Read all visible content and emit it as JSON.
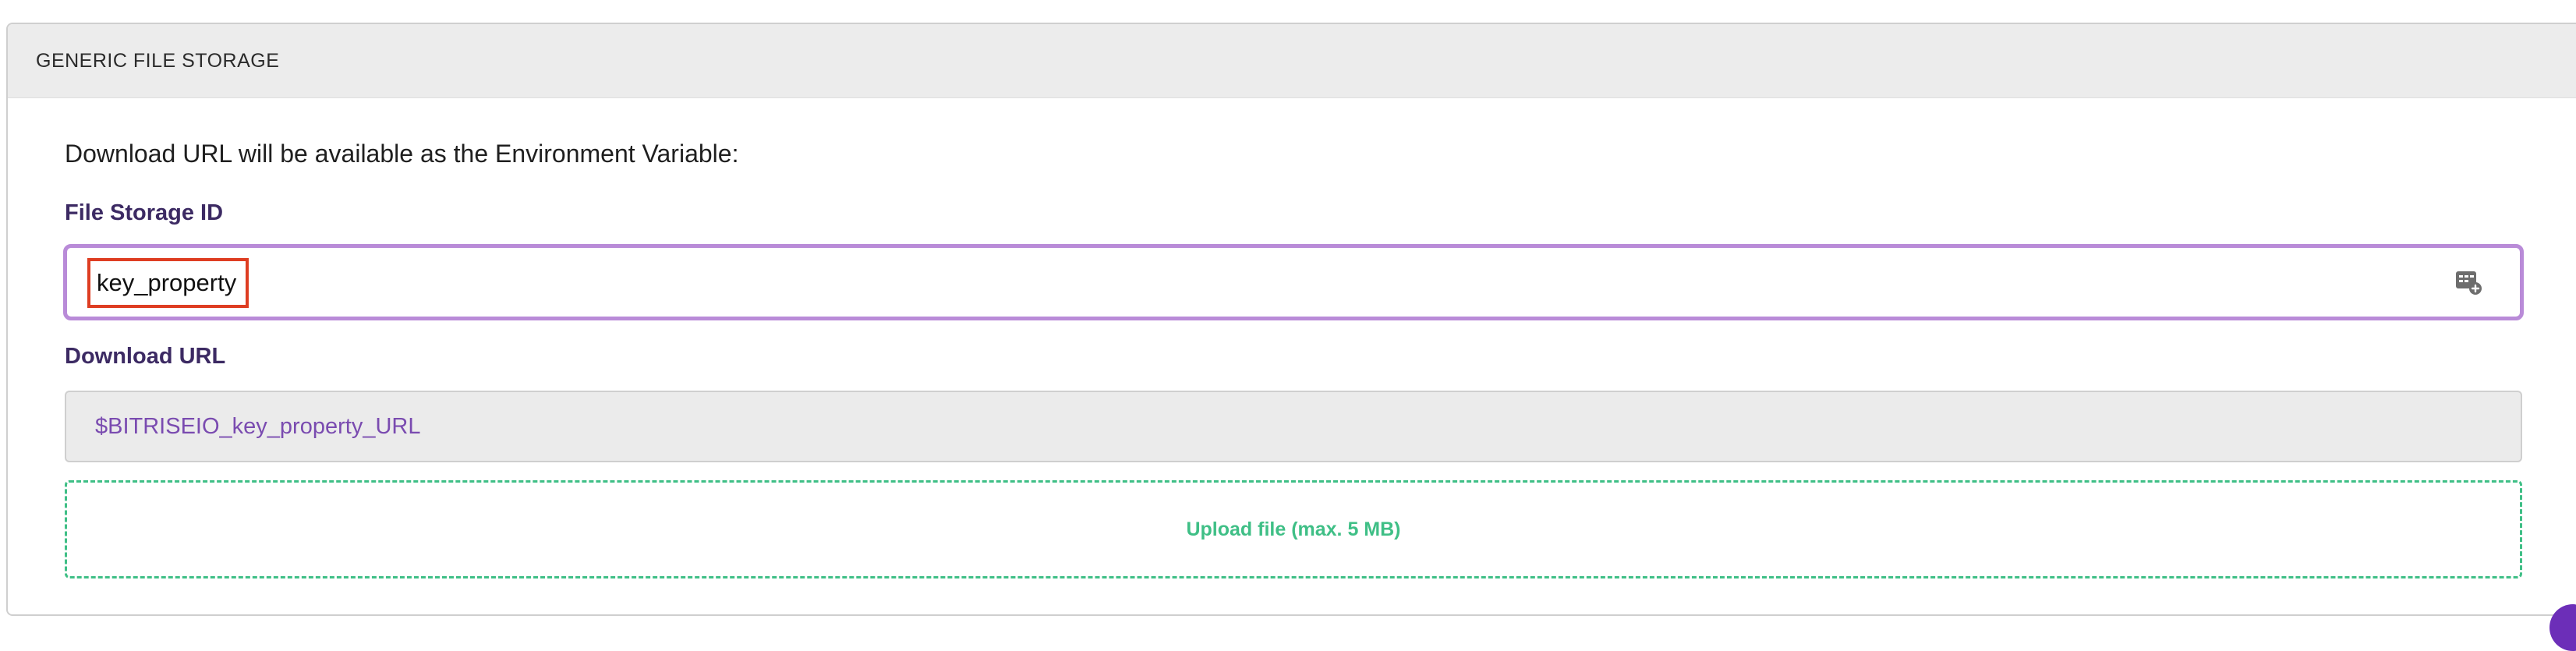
{
  "section": {
    "title": "GENERIC FILE STORAGE",
    "intro_text": "Download URL will be available as the Environment Variable:"
  },
  "file_storage_id": {
    "label": "File Storage ID",
    "value": "key_property",
    "insert_variable_icon": "insert-variable-icon"
  },
  "download_url": {
    "label": "Download URL",
    "value": "$BITRISEIO_key_property_URL"
  },
  "upload": {
    "label": "Upload file (max. 5 MB)"
  },
  "colors": {
    "header_bg": "#ececec",
    "label_color": "#3c2a63",
    "input_focus_border": "#b98bd8",
    "highlight_box": "#de3d22",
    "url_text": "#7a4bb0",
    "upload_accent": "#3fbf86",
    "corner_badge": "#6c2eb8"
  }
}
